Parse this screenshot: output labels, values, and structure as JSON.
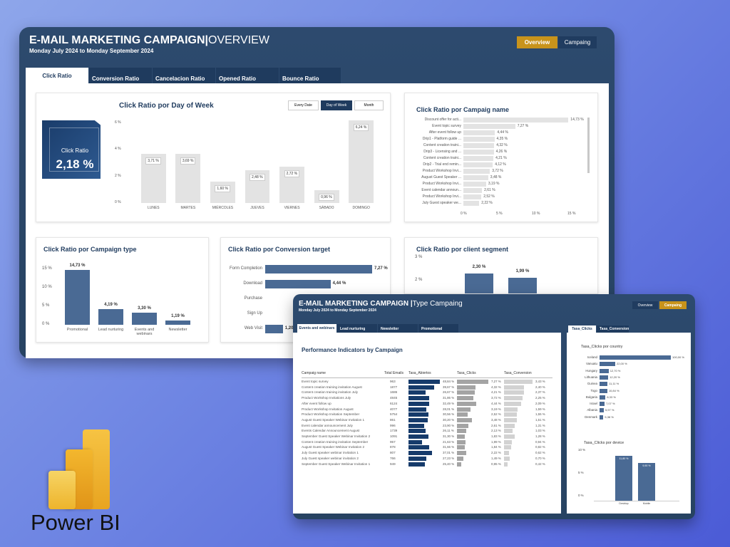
{
  "w1": {
    "title": "E-MAIL MARKETING CAMPAIGN",
    "title_sep": "|",
    "title_sub": "OVERVIEW",
    "subtitle": "Monday July  2024 to Monday September 2024",
    "nav": {
      "overview": "Overview",
      "campaing": "Campaing"
    },
    "tabs": [
      "Click Ratio",
      "Conversion Ratio",
      "Cancelacion Ratio",
      "Opened Ratio",
      "Bounce Ratio"
    ],
    "kpi": {
      "label": "Click Ratio",
      "value": "2,18 %"
    },
    "dow": {
      "title": "Click Ratio por Day of Week",
      "toggles": [
        "Every Date",
        "Day of Week",
        "Month"
      ]
    },
    "campname": {
      "title": "Click Ratio por Campaig name"
    },
    "camptype": {
      "title": "Click Ratio por Campaign type"
    },
    "convtarget": {
      "title": "Click Ratio por Conversion target"
    },
    "segment": {
      "title": "Click Ratio por client segment"
    }
  },
  "w2": {
    "title": "E-MAIL MARKETING CAMPAIGN |",
    "title_sub": "Type Campaing",
    "subtitle": "Monday July  2024 to Monday September 2024",
    "nav": {
      "overview": "Overview",
      "campaing": "Campaing"
    },
    "tabs": [
      "Events and webinars",
      "Lead nurturing",
      "Newsletter",
      "Promotional"
    ],
    "rtabs": [
      "Tasa_Clicks",
      "Tasa_Conversion"
    ],
    "perf": {
      "title": "Performance Indicators by Campaign",
      "cols": [
        "Campaig name",
        "Total Emails",
        "Tasa_Abiertos",
        "Tasa_Clicks",
        "Tasa_Conversion"
      ]
    },
    "country": {
      "title": "Tasa_Clicks por country"
    },
    "device": {
      "title": "Tasa_Clicks por device"
    }
  },
  "brand": {
    "name": "Power BI"
  },
  "chart_data": [
    {
      "type": "bar",
      "title": "Click Ratio por Day of Week",
      "categories": [
        "LUNES",
        "MARTES",
        "MIÉRCOLES",
        "JUEVES",
        "VIERNES",
        "SÁBADO",
        "DOMINGO"
      ],
      "values": [
        3.71,
        3.69,
        1.6,
        2.48,
        2.72,
        0.96,
        6.24
      ],
      "labels": [
        "3,71 %",
        "3,69 %",
        "1,60 %",
        "2,48 %",
        "2,72 %",
        "0,96 %",
        "6,24 %"
      ],
      "yticks": [
        "0 %",
        "2 %",
        "4 %",
        "6 %"
      ],
      "ylim": [
        0,
        6
      ]
    },
    {
      "type": "bar",
      "title": "Click Ratio por Campaig name",
      "categories": [
        "Discount offer for acti...",
        "Event topic survey",
        "After event follow up",
        "Drip1 - Platform guide ...",
        "Content creation traini...",
        "Drip3 - Licensing and ...",
        "Content creation traini...",
        "Drip2 - Trial end remin...",
        "Product Workshop Invi...",
        "August Guest Speaker ...",
        "Product Workshop Invi...",
        "Event calendar announ...",
        "Product Workshop Invi...",
        "July Guest speaker we..."
      ],
      "values": [
        14.73,
        7.27,
        4.44,
        4.35,
        4.32,
        4.26,
        4.21,
        4.12,
        3.72,
        3.48,
        3.19,
        2.61,
        2.52,
        2.22
      ],
      "labels": [
        "14,73 %",
        "7,27 %",
        "4,44 %",
        "4,35 %",
        "4,32 %",
        "4,26 %",
        "4,21 %",
        "4,12 %",
        "3,72 %",
        "3,48 %",
        "3,19 %",
        "2,61 %",
        "2,52 %",
        "2,22 %"
      ],
      "xticks": [
        "0 %",
        "5 %",
        "10 %",
        "15 %"
      ],
      "xlim": [
        0,
        15
      ]
    },
    {
      "type": "bar",
      "title": "Click Ratio por Campaign type",
      "categories": [
        "Promotional",
        "Lead nurturing",
        "Events and webinars",
        "Newsletter"
      ],
      "values": [
        14.73,
        4.19,
        3.3,
        1.19
      ],
      "labels": [
        "14,73 %",
        "4,19 %",
        "3,30 %",
        "1,19 %"
      ],
      "yticks": [
        "0 %",
        "5 %",
        "10 %",
        "15 %"
      ],
      "ylim": [
        0,
        15
      ]
    },
    {
      "type": "bar",
      "title": "Click Ratio por Conversion target",
      "categories": [
        "Form Completion",
        "Download",
        "Purchase",
        "Sign Up",
        "Web Visit"
      ],
      "values": [
        7.27,
        4.44,
        null,
        null,
        1.2
      ],
      "labels": [
        "7,27 %",
        "4,44 %",
        "",
        "",
        "1,20"
      ]
    },
    {
      "type": "bar",
      "title": "Click Ratio por client segment",
      "values": [
        2.3,
        1.99
      ],
      "labels": [
        "2,30 %",
        "1,99 %"
      ],
      "yticks": [
        "3 %",
        "2 %"
      ]
    },
    {
      "type": "table",
      "title": "Performance Indicators by Campaign",
      "columns": [
        "Campaig name",
        "Total Emails",
        "Tasa_Abiertos",
        "Tasa_Clicks",
        "Tasa_Conversion"
      ],
      "rows": [
        [
          "Event topic survey",
          "963",
          "48,84 %",
          "7,27 %",
          "3,43 %"
        ],
        [
          "Content creation training invitation August",
          "1877",
          "39,67 %",
          "4,32 %",
          "2,40 %"
        ],
        [
          "Content creation training invitation July",
          "1686",
          "26,67 %",
          "4,21 %",
          "2,37 %"
        ],
        [
          "Product Workshop Invitations July",
          "4845",
          "31,86 %",
          "3,72 %",
          "2,25 %"
        ],
        [
          "After event follow up",
          "6124",
          "32,49 %",
          "4,44 %",
          "2,09 %"
        ],
        [
          "Product Workshop Invitation August",
          "4077",
          "28,01 %",
          "3,19 %",
          "1,59 %"
        ],
        [
          "Product Workshop Invitation September",
          "5754",
          "30,56 %",
          "2,52 %",
          "1,55 %"
        ],
        [
          "August Guest Speaker Webinar Invitation 1",
          "861",
          "30,20 %",
          "3,48 %",
          "1,51 %"
        ],
        [
          "Event calendar announcement July",
          "996",
          "23,90 %",
          "2,61 %",
          "1,31 %"
        ],
        [
          "Events Calendar Announcement August",
          "1739",
          "26,11 %",
          "2,13 %",
          "1,03 %"
        ],
        [
          "September Guest Speaker Webinar Invitation 2",
          "1091",
          "31,30 %",
          "1,83 %",
          "1,28 %"
        ],
        [
          "Content creation training invitation September",
          "957",
          "21,63 %",
          "1,99 %",
          "0,94 %"
        ],
        [
          "August Guest Speaker Webinar Invitation 2",
          "878",
          "31,66 %",
          "1,84 %",
          "0,82 %"
        ],
        [
          "July Guest speaker webinar invitation 1",
          "807",
          "37,01 %",
          "2,22 %",
          "0,62 %"
        ],
        [
          "July Guest speaker webinar invitation 2",
          "766",
          "27,23 %",
          "1,49 %",
          "0,70 %"
        ],
        [
          "September Guest Speaker Webinar Invitation 1",
          "949",
          "25,40 %",
          "0,95 %",
          "0,42 %"
        ]
      ]
    },
    {
      "type": "bar",
      "title": "Tasa_Clicks por country",
      "categories": [
        "Iceland",
        "Vanuatu",
        "Hungary",
        "Lithuania",
        "Guinea",
        "Togo",
        "Bulgaria",
        "Israel",
        "Albania",
        "Denmark"
      ],
      "values": [
        100,
        22,
        12.7,
        12.2,
        11.11,
        10.84,
        8.33,
        7.07,
        5.97,
        5.38
      ],
      "labels": [
        "100,00 %",
        "22,00 %",
        "12,70 %",
        "12,20 %",
        "11,11 %",
        "10,84 %",
        "8,33 %",
        "7,07 %",
        "5,97 %",
        "5,38 %"
      ]
    },
    {
      "type": "bar",
      "title": "Tasa_Clicks por device",
      "categories": [
        "Desktop",
        "Mobile"
      ],
      "values": [
        11.8,
        9.9
      ],
      "labels": [
        "11,80 %",
        "9,90 %"
      ],
      "yticks": [
        "10 %",
        "5 %",
        "0 %"
      ]
    }
  ]
}
